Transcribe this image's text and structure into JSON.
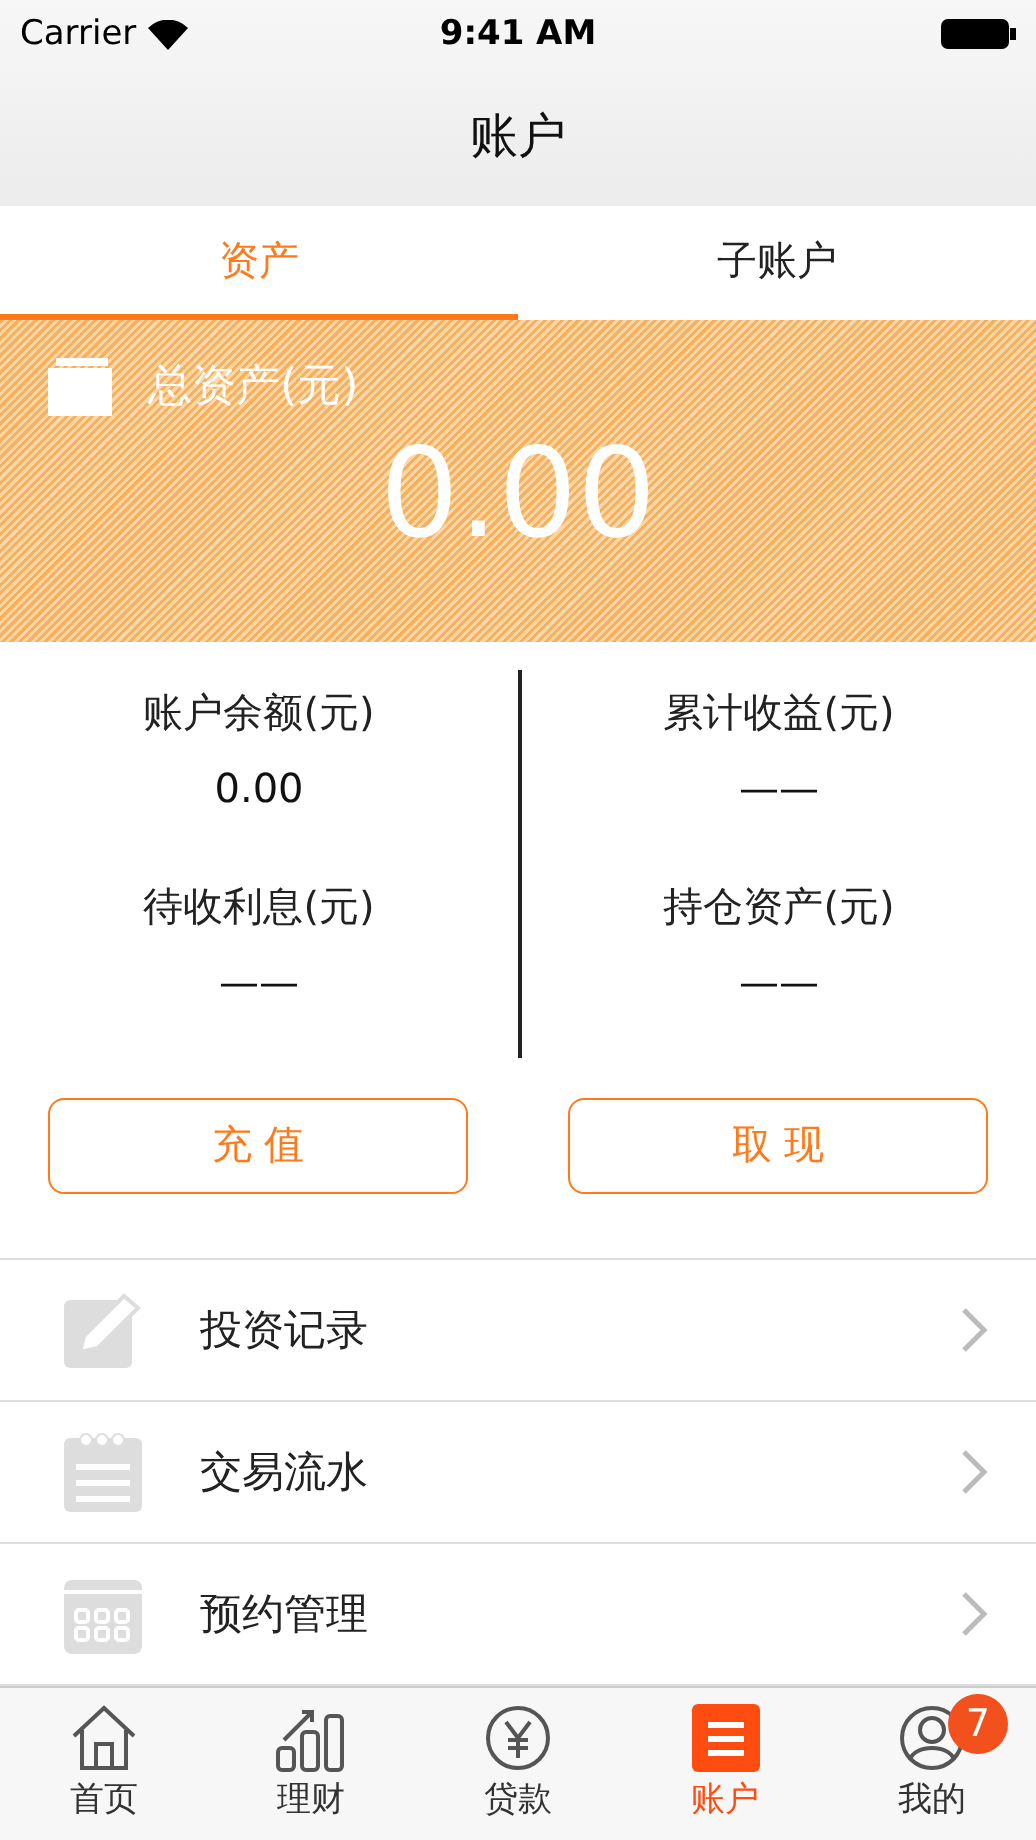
{
  "status_bar": {
    "carrier": "Carrier",
    "time": "9:41 AM"
  },
  "nav": {
    "title": "账户"
  },
  "tabs": [
    {
      "label": "资产",
      "selected": true
    },
    {
      "label": "子账户",
      "selected": false
    }
  ],
  "total": {
    "label": "总资产(元)",
    "value": "0.00"
  },
  "stats": [
    {
      "label": "账户余额(元)",
      "value": "0.00"
    },
    {
      "label": "累计收益(元)",
      "value": "——"
    },
    {
      "label": "待收利息(元)",
      "value": "——"
    },
    {
      "label": "持仓资产(元)",
      "value": "——"
    }
  ],
  "actions": [
    "充 值",
    "取 现"
  ],
  "menu": [
    {
      "kind": "pencil",
      "label": "投资记录"
    },
    {
      "kind": "notepad",
      "label": "交易流水"
    },
    {
      "kind": "calendar",
      "label": "预约管理"
    }
  ],
  "tabbar": [
    {
      "kind": "home",
      "label": "首页",
      "selected": false
    },
    {
      "kind": "chart",
      "label": "理财",
      "selected": false
    },
    {
      "kind": "yen",
      "label": "贷款",
      "selected": false
    },
    {
      "kind": "list",
      "label": "账户",
      "selected": true
    },
    {
      "kind": "person",
      "label": "我的",
      "selected": false,
      "badge": "7"
    }
  ]
}
